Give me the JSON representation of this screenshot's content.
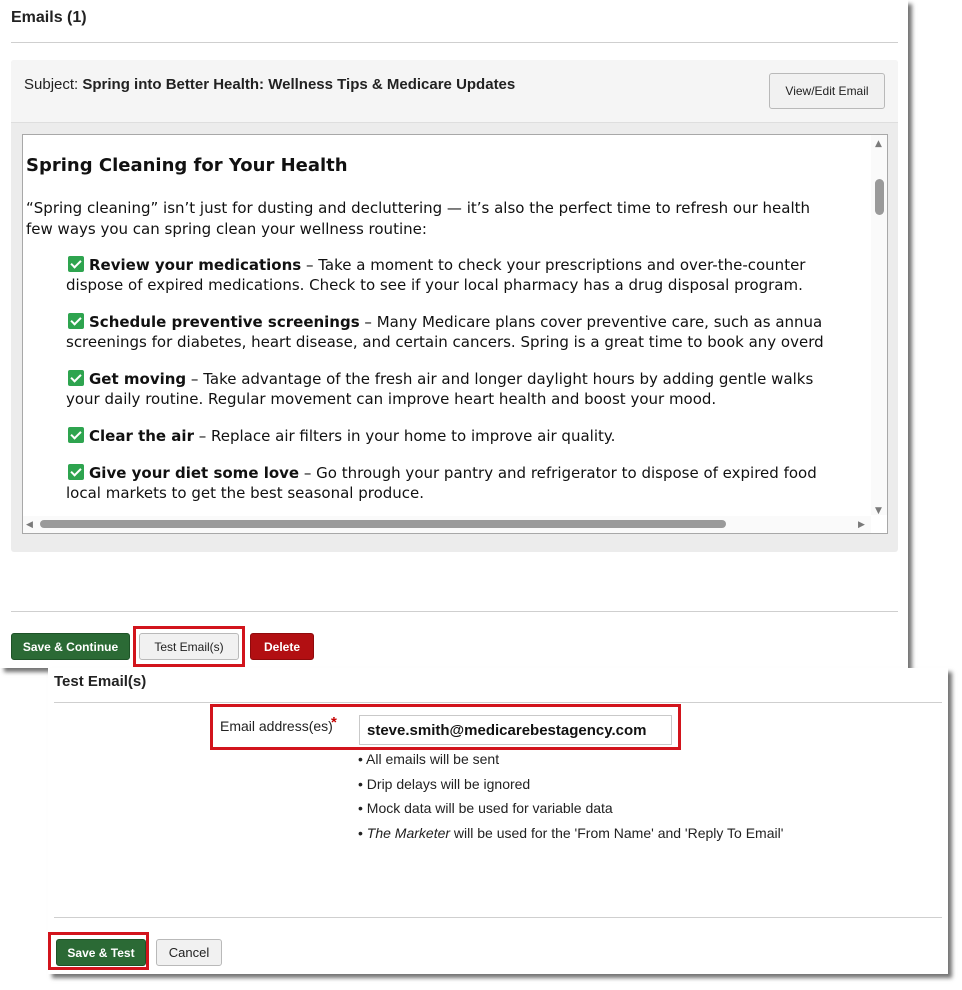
{
  "emails_section": {
    "title": "Emails (1)",
    "subject_label": "Subject:",
    "subject_value": "Spring into Better Health: Wellness Tips & Medicare Updates",
    "view_edit_label": "View/Edit Email",
    "preview": {
      "heading": "Spring Cleaning for Your Health",
      "intro_line1": "“Spring cleaning” isn’t just for dusting and decluttering — it’s also the perfect time to refresh our health",
      "intro_line2": "few ways you can spring clean your wellness routine:",
      "items": [
        {
          "title": "Review your medications",
          "text1": " – Take a moment to check your prescriptions and over-the-counter",
          "text2": "dispose of expired medications. Check to see if your local pharmacy has a drug disposal program."
        },
        {
          "title": "Schedule preventive screenings",
          "text1": " – Many Medicare plans cover preventive care, such as annua",
          "text2": "screenings for diabetes, heart disease, and certain cancers. Spring is a great time to book any overd"
        },
        {
          "title": "Get moving",
          "text1": " – Take advantage of the fresh air and longer daylight hours by adding gentle walks",
          "text2": "your daily routine. Regular movement can improve heart health and boost your mood."
        },
        {
          "title": "Clear the air",
          "text1": " – Replace air filters in your home to improve air quality.",
          "text2": ""
        },
        {
          "title": "Give your diet some love",
          "text1": " – Go through your pantry and refrigerator to dispose of expired food",
          "text2": "local markets to get the best seasonal produce."
        }
      ]
    },
    "buttons": {
      "save_continue": "Save & Continue",
      "test_emails": "Test Email(s)",
      "delete": "Delete"
    }
  },
  "test_section": {
    "title": "Test Email(s)",
    "email_label": "Email address(es)",
    "required_mark": "*",
    "email_value": "steve.smith@medicarebestagency.com",
    "notes": [
      "All emails will be sent",
      "Drip delays will be ignored",
      "Mock data will be used for variable data"
    ],
    "marketer_note_name": "The Marketer",
    "marketer_note_rest": " will be used for the 'From Name' and 'Reply To Email'",
    "bullet": "•",
    "buttons": {
      "save_test": "Save & Test",
      "cancel": "Cancel"
    }
  },
  "colors": {
    "highlight": "#d2141c",
    "primary_green": "#2b6a35",
    "danger_red": "#b20f12",
    "check_green": "#2ea44f"
  },
  "icons": {
    "check": "check-box-icon",
    "scroll_up": "scroll-up-arrow-icon",
    "scroll_down": "scroll-down-arrow-icon",
    "scroll_left": "scroll-left-arrow-icon",
    "scroll_right": "scroll-right-arrow-icon"
  }
}
